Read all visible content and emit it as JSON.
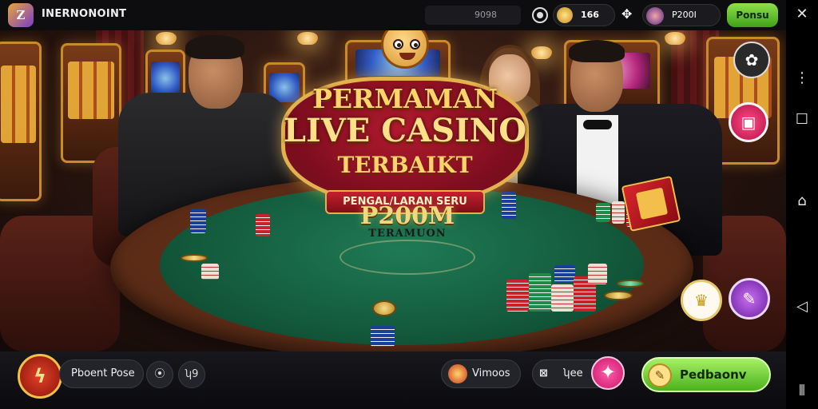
{
  "topbar": {
    "app_title": "INERNONOINT",
    "search_value": "9098",
    "coin_balance": "166",
    "username": "P200I",
    "deposit_label": "Ponsu"
  },
  "logo": {
    "line1": "PERMAMAN",
    "line2": "LIVE CASINO",
    "line3": "TERBAIKT",
    "ribbon": "PENGAL/LARAN SERU"
  },
  "table": {
    "pot_amount": "P200M",
    "pot_label": "TERAMUON"
  },
  "bottombar": {
    "profile_label": "Pboent Pose",
    "round_1": "⦿",
    "round_2": "ʮ9",
    "wallet_label": "Vimoos",
    "ticket_label": "ʮee",
    "main_button_label": "Pedbaonv"
  },
  "icons": {
    "flower": "flower-icon",
    "gift": "gift-icon",
    "crown": "crown-icon",
    "vip": "vip-icon"
  },
  "colors": {
    "accent_green": "#6ccf2f",
    "accent_gold": "#e2b24e",
    "logo_red": "#b31a2e",
    "felt_green": "#1f7a55"
  }
}
